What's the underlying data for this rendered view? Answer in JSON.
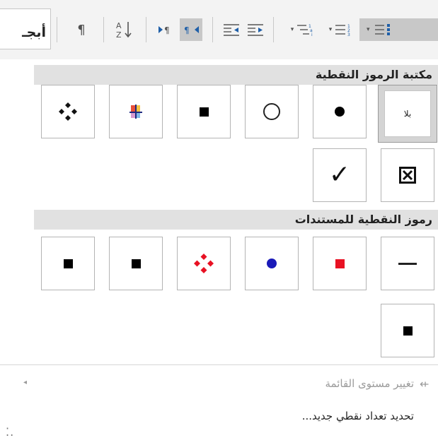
{
  "ribbon": {
    "style_preview_text": "أبجـ",
    "dropdown_caret": "▾"
  },
  "gallery": {
    "library_header": "مكتبة الرموز النقطية",
    "document_header": "رموز النقطية للمستندات",
    "none_label": "بلا",
    "check_glyph": "✓",
    "boxed_x_glyph": "☒",
    "diamond_glyph": "❖"
  },
  "colors": {
    "red_bullet": "#e81123",
    "blue_bullet": "#1a1ab8",
    "selected_cell": "#d4d4d4"
  },
  "menu": {
    "change_list_level": "تغيير مستوى القائمة",
    "define_new_bullet": "تحديد تعداد نقطي جديد...",
    "submenu_arrow": "◂",
    "change_level_icon": "⇷"
  },
  "resize_grip": "⁚."
}
